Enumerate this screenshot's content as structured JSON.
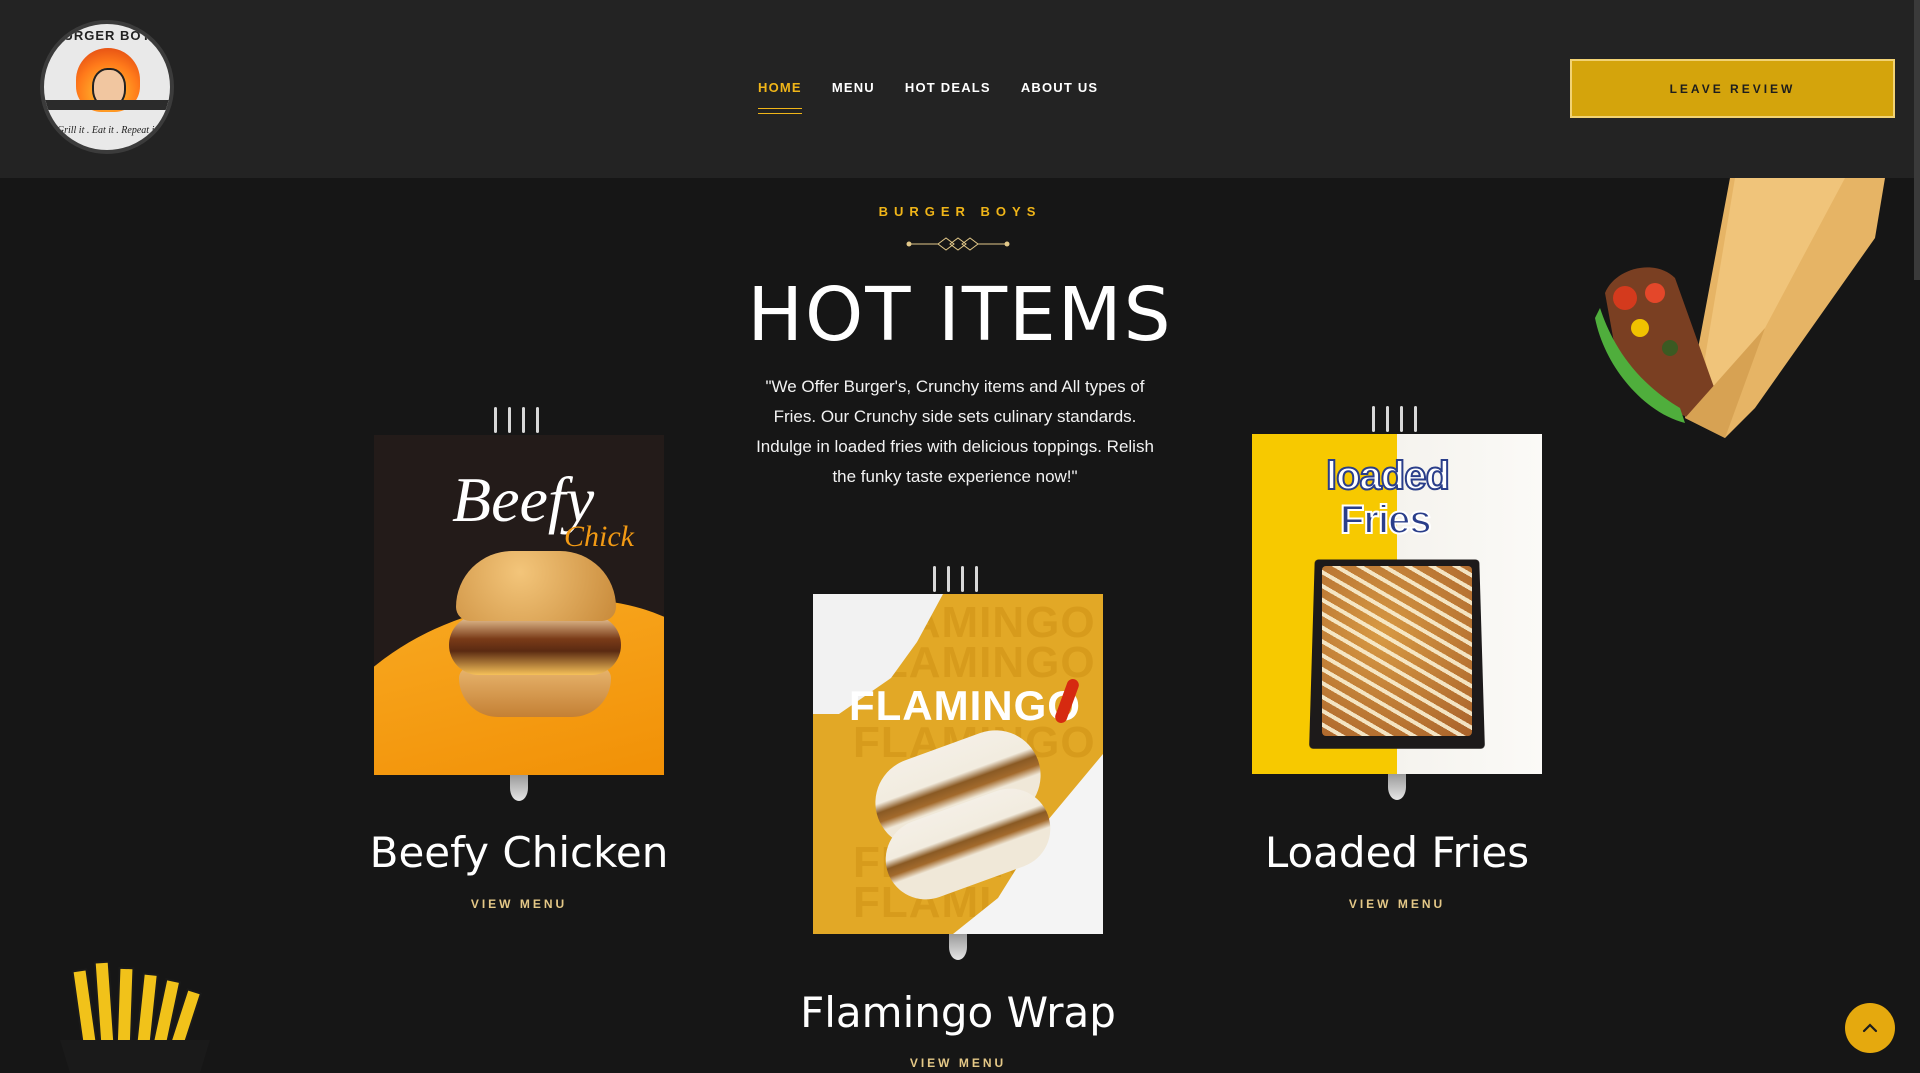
{
  "header": {
    "logo": {
      "top_text": "BURGER BOYS",
      "tagline": "Grill it . Eat it . Repeat it"
    },
    "nav": [
      {
        "label": "HOME",
        "active": true
      },
      {
        "label": "MENU",
        "active": false
      },
      {
        "label": "HOT DEALS",
        "active": false
      },
      {
        "label": "ABOUT US",
        "active": false
      }
    ],
    "cta": "LEAVE REVIEW"
  },
  "section": {
    "eyebrow": "BURGER BOYS",
    "title": "HOT ITEMS",
    "description": "\"We Offer Burger's, Crunchy items and All types of Fries. Our Crunchy side sets culinary standards. Indulge in loaded fries with delicious toppings. Relish the funky taste experience now!\""
  },
  "cards": [
    {
      "title": "Beefy Chicken",
      "link": "VIEW MENU",
      "image_text": [
        "Beefy",
        "Chick"
      ]
    },
    {
      "title": "Flamingo Wrap",
      "link": "VIEW MENU",
      "image_text": [
        "FLAMINGO"
      ],
      "image_bg_text": [
        "FLAMINGO",
        "FLAMINGO",
        "FLAMINGO",
        "FLAMINGO",
        "FLAMI"
      ]
    },
    {
      "title": "Loaded Fries",
      "link": "VIEW MENU",
      "image_text": [
        "loaded",
        "Fries"
      ]
    }
  ],
  "icons": {
    "scroll_top": "chevron-up-icon",
    "divider": "diamond-divider-icon"
  },
  "colors": {
    "accent": "#f0b518",
    "header_bg": "#232323",
    "page_bg": "#161616",
    "button_bg": "#d4a40c"
  }
}
